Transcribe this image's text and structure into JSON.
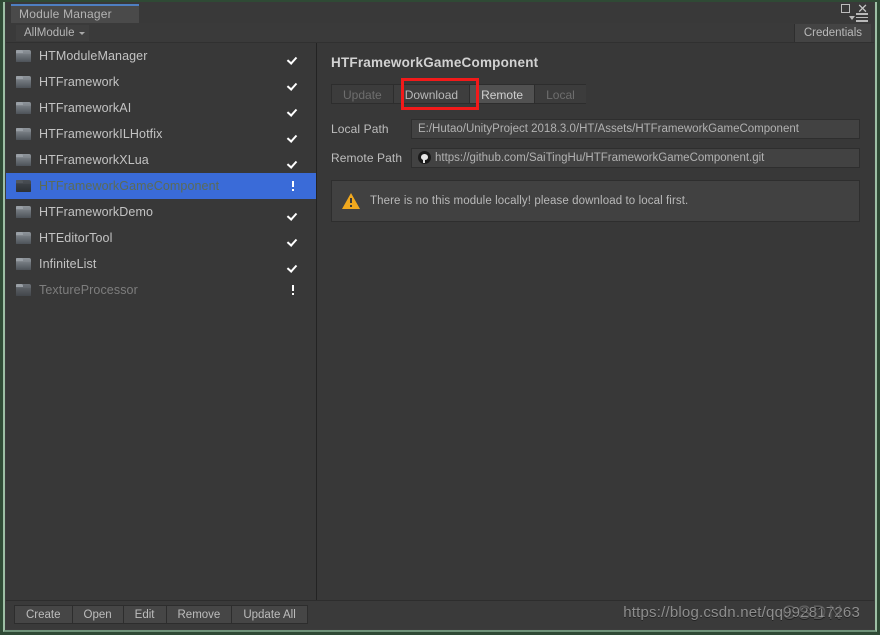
{
  "window": {
    "tab_title": "Module Manager",
    "maximize_icon": "maximize-icon",
    "close_icon": "close-icon",
    "menu_icon": "hamburger-menu-icon"
  },
  "toolbar": {
    "filter_label": "AllModule",
    "filter_caret_icon": "chevron-down-icon",
    "credentials_label": "Credentials"
  },
  "module_list": [
    {
      "name": "HTModuleManager",
      "status": "ok",
      "selected": false,
      "dim": false
    },
    {
      "name": "HTFramework",
      "status": "ok",
      "selected": false,
      "dim": false
    },
    {
      "name": "HTFrameworkAI",
      "status": "ok",
      "selected": false,
      "dim": false
    },
    {
      "name": "HTFrameworkILHotfix",
      "status": "ok",
      "selected": false,
      "dim": false
    },
    {
      "name": "HTFrameworkXLua",
      "status": "ok",
      "selected": false,
      "dim": false
    },
    {
      "name": "HTFrameworkGameComponent",
      "status": "error",
      "selected": true,
      "dim": false
    },
    {
      "name": "HTFrameworkDemo",
      "status": "ok",
      "selected": false,
      "dim": false
    },
    {
      "name": "HTEditorTool",
      "status": "ok",
      "selected": false,
      "dim": false
    },
    {
      "name": "InfiniteList",
      "status": "ok",
      "selected": false,
      "dim": false
    },
    {
      "name": "TextureProcessor",
      "status": "error",
      "selected": false,
      "dim": true
    }
  ],
  "detail": {
    "title": "HTFrameworkGameComponent",
    "tabs": [
      {
        "label": "Local",
        "state": "disabled"
      },
      {
        "label": "Remote",
        "state": "active"
      },
      {
        "label": "Download",
        "state": "normal"
      },
      {
        "label": "Update",
        "state": "disabled"
      }
    ],
    "highlight_target": "Download",
    "highlight_color": "#f21a1a",
    "local_path_label": "Local Path",
    "local_path_value": "E:/Hutao/UnityProject 2018.3.0/HT/Assets/HTFrameworkGameComponent",
    "remote_path_label": "Remote Path",
    "remote_path_icon": "github-icon",
    "remote_path_value": "https://github.com/SaiTingHu/HTFrameworkGameComponent.git",
    "warning_icon": "warning-triangle-icon",
    "warning_text": "There is no this module locally! please download to local first."
  },
  "bottom_buttons": [
    {
      "label": "Create"
    },
    {
      "label": "Open"
    },
    {
      "label": "Edit"
    },
    {
      "label": "Remove"
    },
    {
      "label": "Update All"
    }
  ],
  "watermark": {
    "url": "https://blog.csdn.net/qq992817263",
    "ghost": "CSDN"
  },
  "colors": {
    "selection_blue": "#3a6bd8",
    "status_ok_green": "#5ea52a",
    "status_error_red": "#e03a2f",
    "warning_amber": "#f0a81e",
    "tab_accent_blue": "#4e7fc1",
    "window_border_green": "#2f4a35"
  }
}
